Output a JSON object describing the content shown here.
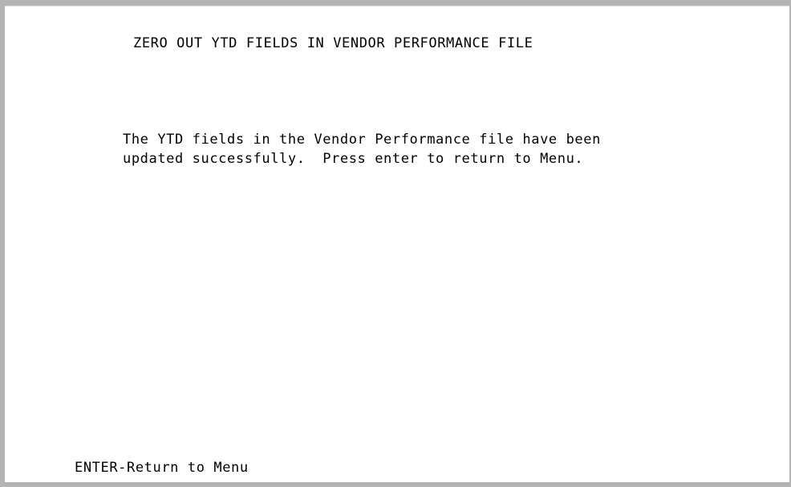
{
  "screen": {
    "title": "ZERO OUT YTD FIELDS IN VENDOR PERFORMANCE FILE",
    "message_lines": [
      "The YTD fields in the Vendor Performance file have been",
      "updated successfully.  Press enter to return to Menu."
    ]
  },
  "function_keys": {
    "enter": "ENTER-Return to Menu"
  },
  "colors": {
    "background": "#ffffff",
    "text": "#000000",
    "frame": "#b4b4b4"
  }
}
